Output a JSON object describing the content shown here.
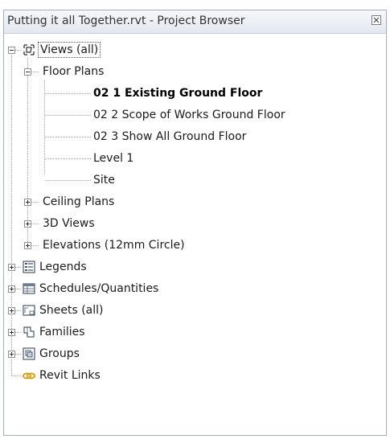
{
  "window": {
    "title": "Putting it all Together.rvt - Project Browser"
  },
  "tree": {
    "views_all": "Views (all)",
    "floor_plans": "Floor Plans",
    "floor_plan_items": [
      "02 1 Existing Ground Floor",
      "02 2 Scope of Works Ground Floor",
      "02 3 Show All Ground Floor",
      "Level 1",
      "Site"
    ],
    "ceiling_plans": "Ceiling Plans",
    "views_3d": "3D Views",
    "elevations": "Elevations (12mm Circle)",
    "legends": "Legends",
    "schedules": "Schedules/Quantities",
    "sheets": "Sheets (all)",
    "families": "Families",
    "groups": "Groups",
    "revit_links": "Revit Links"
  },
  "icons": {
    "views": "views-icon",
    "legends": "legend-icon",
    "schedules": "schedule-icon",
    "sheets": "sheet-icon",
    "families": "family-icon",
    "groups": "group-icon",
    "revit_links": "link-icon"
  },
  "colors": {
    "link_icon": "#d9a21e",
    "tree_guides": "#a0a0a0"
  }
}
